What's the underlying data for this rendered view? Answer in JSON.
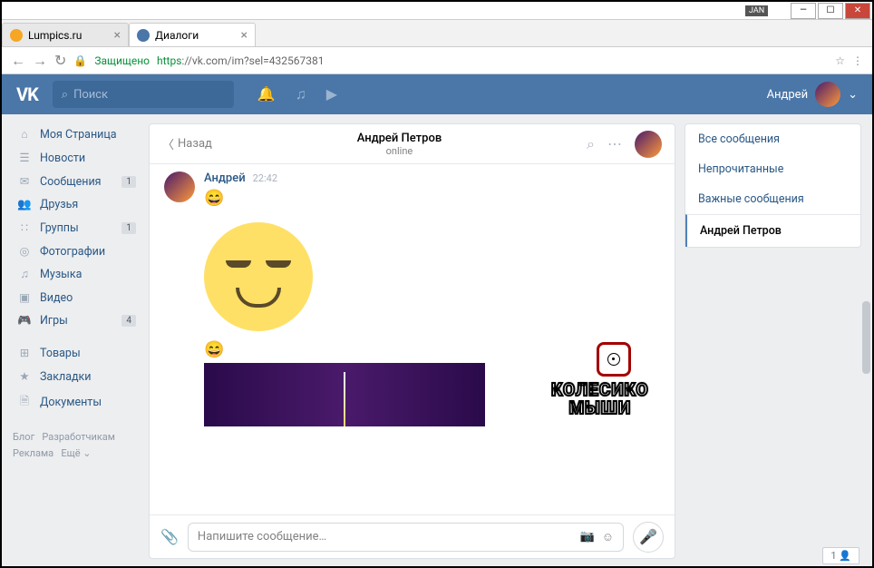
{
  "window": {
    "jan": "JAN"
  },
  "tabs": [
    {
      "label": "Lumpics.ru",
      "fav": "#f6a623",
      "active": false
    },
    {
      "label": "Диалоги",
      "fav": "#4a76a8",
      "active": true
    }
  ],
  "addr": {
    "secure": "Защищено",
    "url": "https://vk.com/im?sel=432567381"
  },
  "search": {
    "placeholder": "Поиск"
  },
  "user": {
    "name": "Андрей"
  },
  "nav": [
    {
      "icon": "⌂",
      "label": "Моя Страница"
    },
    {
      "icon": "☰",
      "label": "Новости"
    },
    {
      "icon": "✉",
      "label": "Сообщения",
      "badge": "1"
    },
    {
      "icon": "👥",
      "label": "Друзья"
    },
    {
      "icon": "∷",
      "label": "Группы",
      "badge": "1"
    },
    {
      "icon": "◎",
      "label": "Фотографии"
    },
    {
      "icon": "♫",
      "label": "Музыка"
    },
    {
      "icon": "▣",
      "label": "Видео"
    },
    {
      "icon": "🎮",
      "label": "Игры",
      "badge": "4"
    }
  ],
  "nav2": [
    {
      "icon": "⊞",
      "label": "Товары"
    },
    {
      "icon": "★",
      "label": "Закладки"
    },
    {
      "icon": "🗎",
      "label": "Документы"
    }
  ],
  "footer": {
    "a": "Блог",
    "b": "Разработчикам",
    "c": "Реклама",
    "d": "Ещё ⌄"
  },
  "chat": {
    "back": "Назад",
    "name": "Андрей Петров",
    "status": "online",
    "sender": "Андрей",
    "time": "22:42",
    "placeholder": "Напишите сообщение…"
  },
  "right": {
    "all": "Все сообщения",
    "unread": "Непрочитанные",
    "important": "Важные сообщения",
    "active": "Андрей Петров"
  },
  "annotation": {
    "l1": "КОЛЕСИКО",
    "l2": "МЫШИ"
  },
  "corner": "1"
}
